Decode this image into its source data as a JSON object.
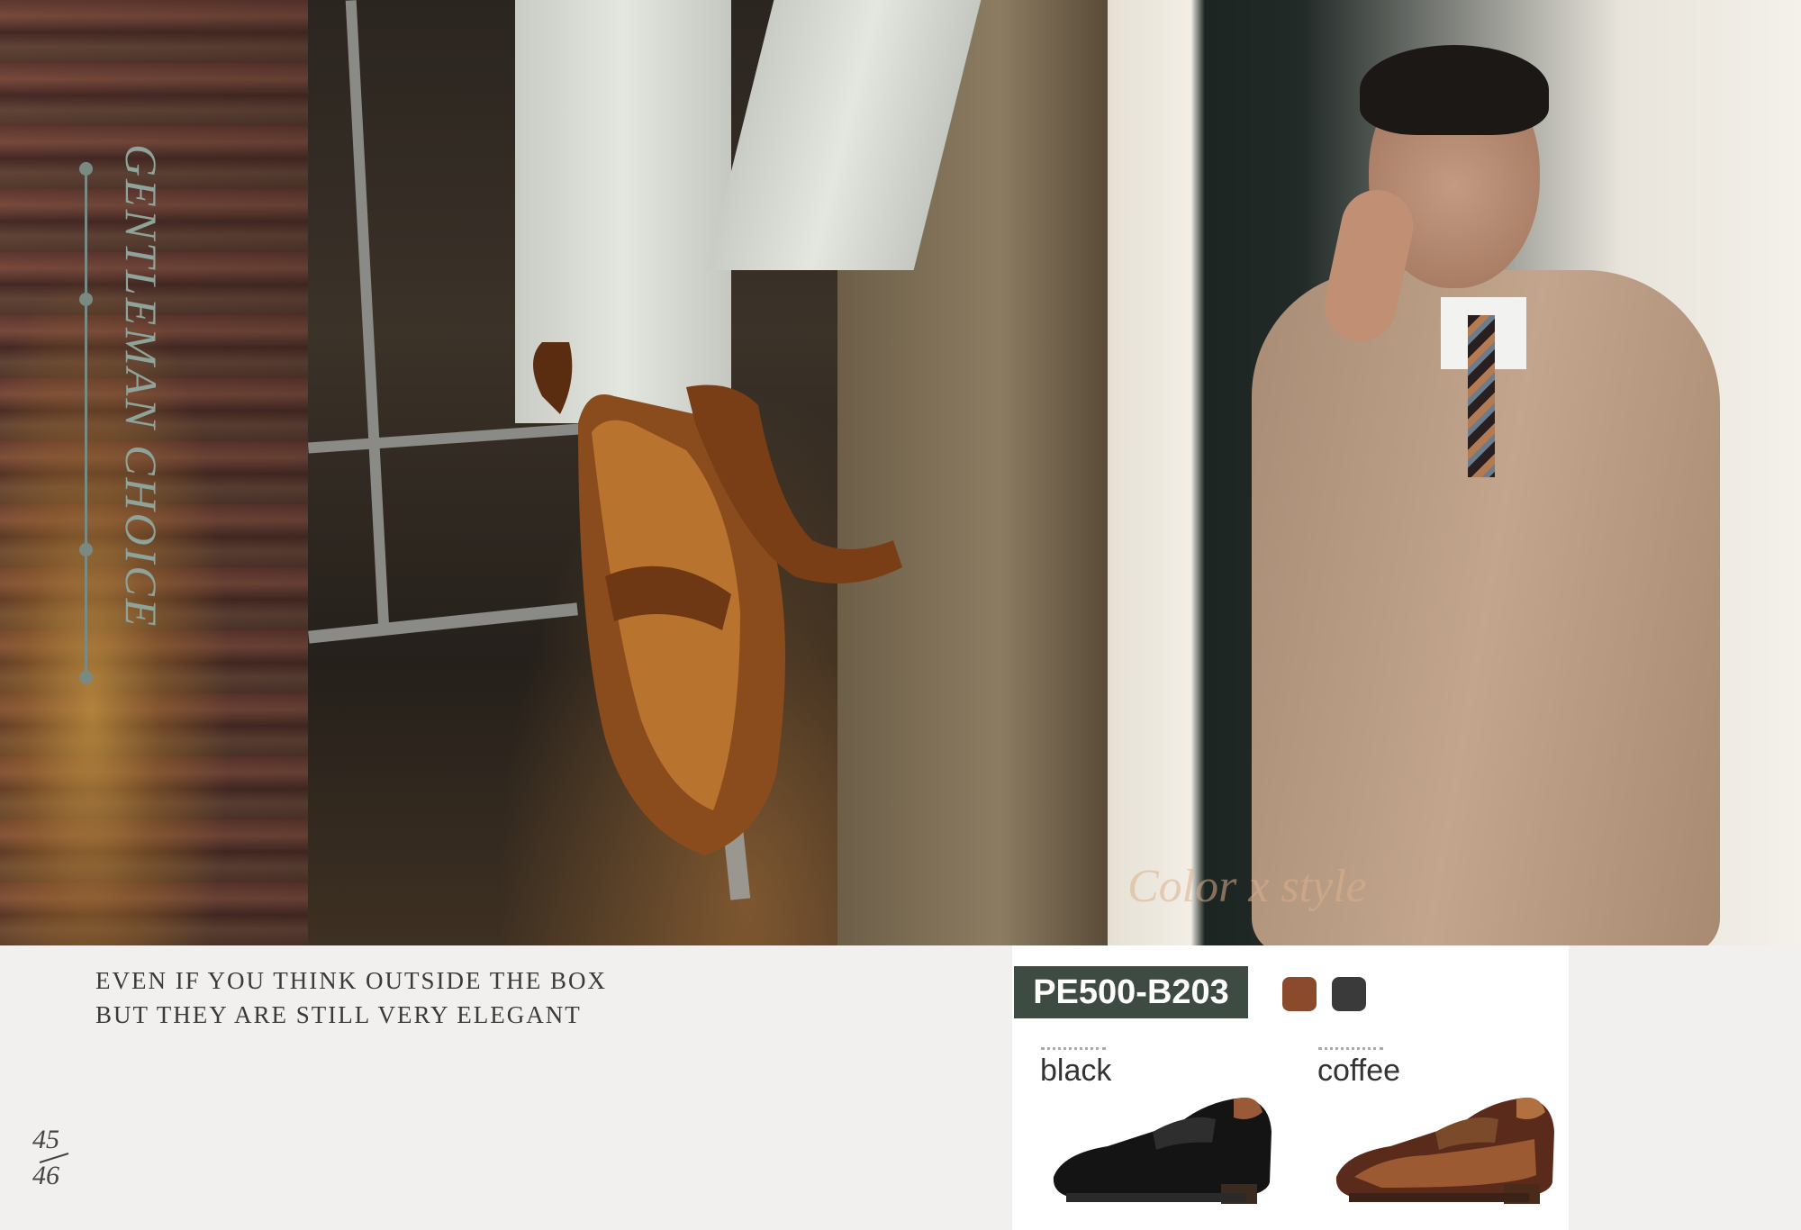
{
  "side_title": "GENTLEMAN CHOICE",
  "watermark": "Color x style",
  "tagline": {
    "line1": "EVEN IF YOU THINK OUTSIDE THE BOX",
    "line2": "BUT THEY ARE STILL VERY ELEGANT"
  },
  "pages": {
    "left": "45",
    "right": "46"
  },
  "product": {
    "code": "PE500-B203",
    "swatches": [
      {
        "name": "coffee",
        "color": "#8b4a2b"
      },
      {
        "name": "black",
        "color": "#3a3a3a"
      }
    ],
    "variants": [
      {
        "label": "black"
      },
      {
        "label": "coffee"
      }
    ]
  }
}
